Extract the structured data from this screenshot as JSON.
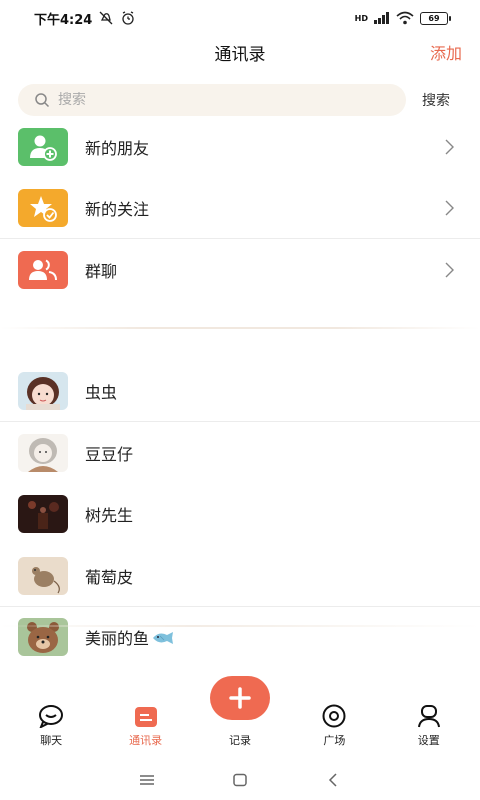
{
  "status_bar": {
    "time": "下午4:24",
    "network": "HD",
    "battery": "69"
  },
  "header": {
    "title": "通讯录",
    "add_label": "添加"
  },
  "search": {
    "placeholder": "搜索",
    "button_label": "搜索"
  },
  "functions": [
    {
      "label": "新的朋友",
      "icon": "add-user-icon",
      "color": "#5bbf6a"
    },
    {
      "label": "新的关注",
      "icon": "star-check-icon",
      "color": "#f4a92c"
    },
    {
      "label": "群聊",
      "icon": "group-icon",
      "color": "#ef6a51"
    }
  ],
  "contacts": [
    {
      "name": "虫虫",
      "avatar": "avatar-girl-red-hair"
    },
    {
      "name": "豆豆仔",
      "avatar": "avatar-sketch-girl"
    },
    {
      "name": "树先生",
      "avatar": "avatar-dark-scene"
    },
    {
      "name": "葡萄皮",
      "avatar": "avatar-mouse-sketch"
    },
    {
      "name": "美丽的鱼",
      "avatar": "avatar-bear",
      "emoji": "fish-emoji"
    }
  ],
  "tabs": [
    {
      "label": "聊天",
      "icon": "chat-icon",
      "active": false
    },
    {
      "label": "通讯录",
      "icon": "contacts-icon",
      "active": true
    },
    {
      "label": "记录",
      "icon": "plus-icon",
      "active": false
    },
    {
      "label": "广场",
      "icon": "eye-icon",
      "active": false
    },
    {
      "label": "设置",
      "icon": "person-icon",
      "active": false
    }
  ],
  "colors": {
    "accent": "#e86a4f",
    "search_bg": "#f8f3ec",
    "green": "#5bbf6a",
    "orange": "#f4a92c",
    "red": "#ef6a51"
  }
}
